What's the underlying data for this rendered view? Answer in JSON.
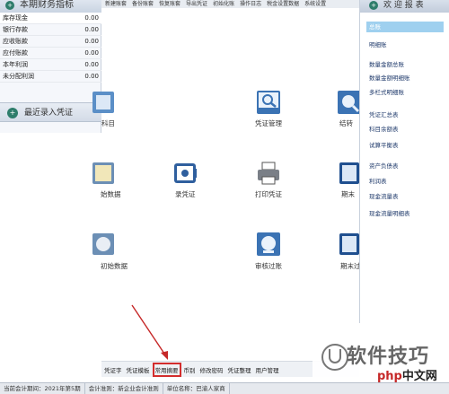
{
  "menubar": [
    "新建账套",
    "备份账套",
    "恢复账套",
    "导出凭证",
    "初始化账",
    "操作日志",
    "税金设置数据",
    "系统设置"
  ],
  "left_panel": {
    "title": "本期财务指标",
    "stats": [
      {
        "label": "库存现金",
        "value": "0.00"
      },
      {
        "label": "银行存款",
        "value": "0.00"
      },
      {
        "label": "应收账款",
        "value": "0.00"
      },
      {
        "label": "应付账款",
        "value": "0.00"
      },
      {
        "label": "本年利润",
        "value": "0.00"
      },
      {
        "label": "未分配利润",
        "value": "0.00"
      }
    ],
    "recent_label": "最近录入凭证"
  },
  "tiles": {
    "kemu": "科目",
    "voucher_mgmt": "凭证管理",
    "closing": "结转",
    "init_data": "始数据",
    "record_voucher": "录凭证",
    "print_voucher": "打印凭证",
    "period_end": "期末",
    "init_data2": "初始数据",
    "audit": "审核过账",
    "period_end2": "期末过"
  },
  "funcbar": [
    "凭证字",
    "凭证模板",
    "常用摘要",
    "币别",
    "修改密码",
    "凭证整理",
    "用户管理"
  ],
  "funcbar_highlight": 2,
  "right_panel": {
    "title": "欢 迎 报 表",
    "selected": "总账",
    "items": [
      {
        "label": "明细账"
      },
      {
        "label": "数量金额总账"
      },
      {
        "label": "数量金额明细账"
      },
      {
        "label": "多栏式明细账"
      },
      {
        "label": "凭证汇总表"
      },
      {
        "label": "科目余额表"
      },
      {
        "label": "试算平衡表"
      },
      {
        "label": "资产负债表"
      },
      {
        "label": "利润表"
      },
      {
        "label": "现金流量表"
      },
      {
        "label": "现金流量明细表"
      }
    ]
  },
  "statusbar": {
    "period": "当前会计期间：2021年第5期",
    "standard": "会计准则：新企业会计准则",
    "company": "单位名称：巴渝人家商"
  },
  "watermark": {
    "text": "软件技巧",
    "site_a": "php",
    "site_b": "中文网"
  }
}
